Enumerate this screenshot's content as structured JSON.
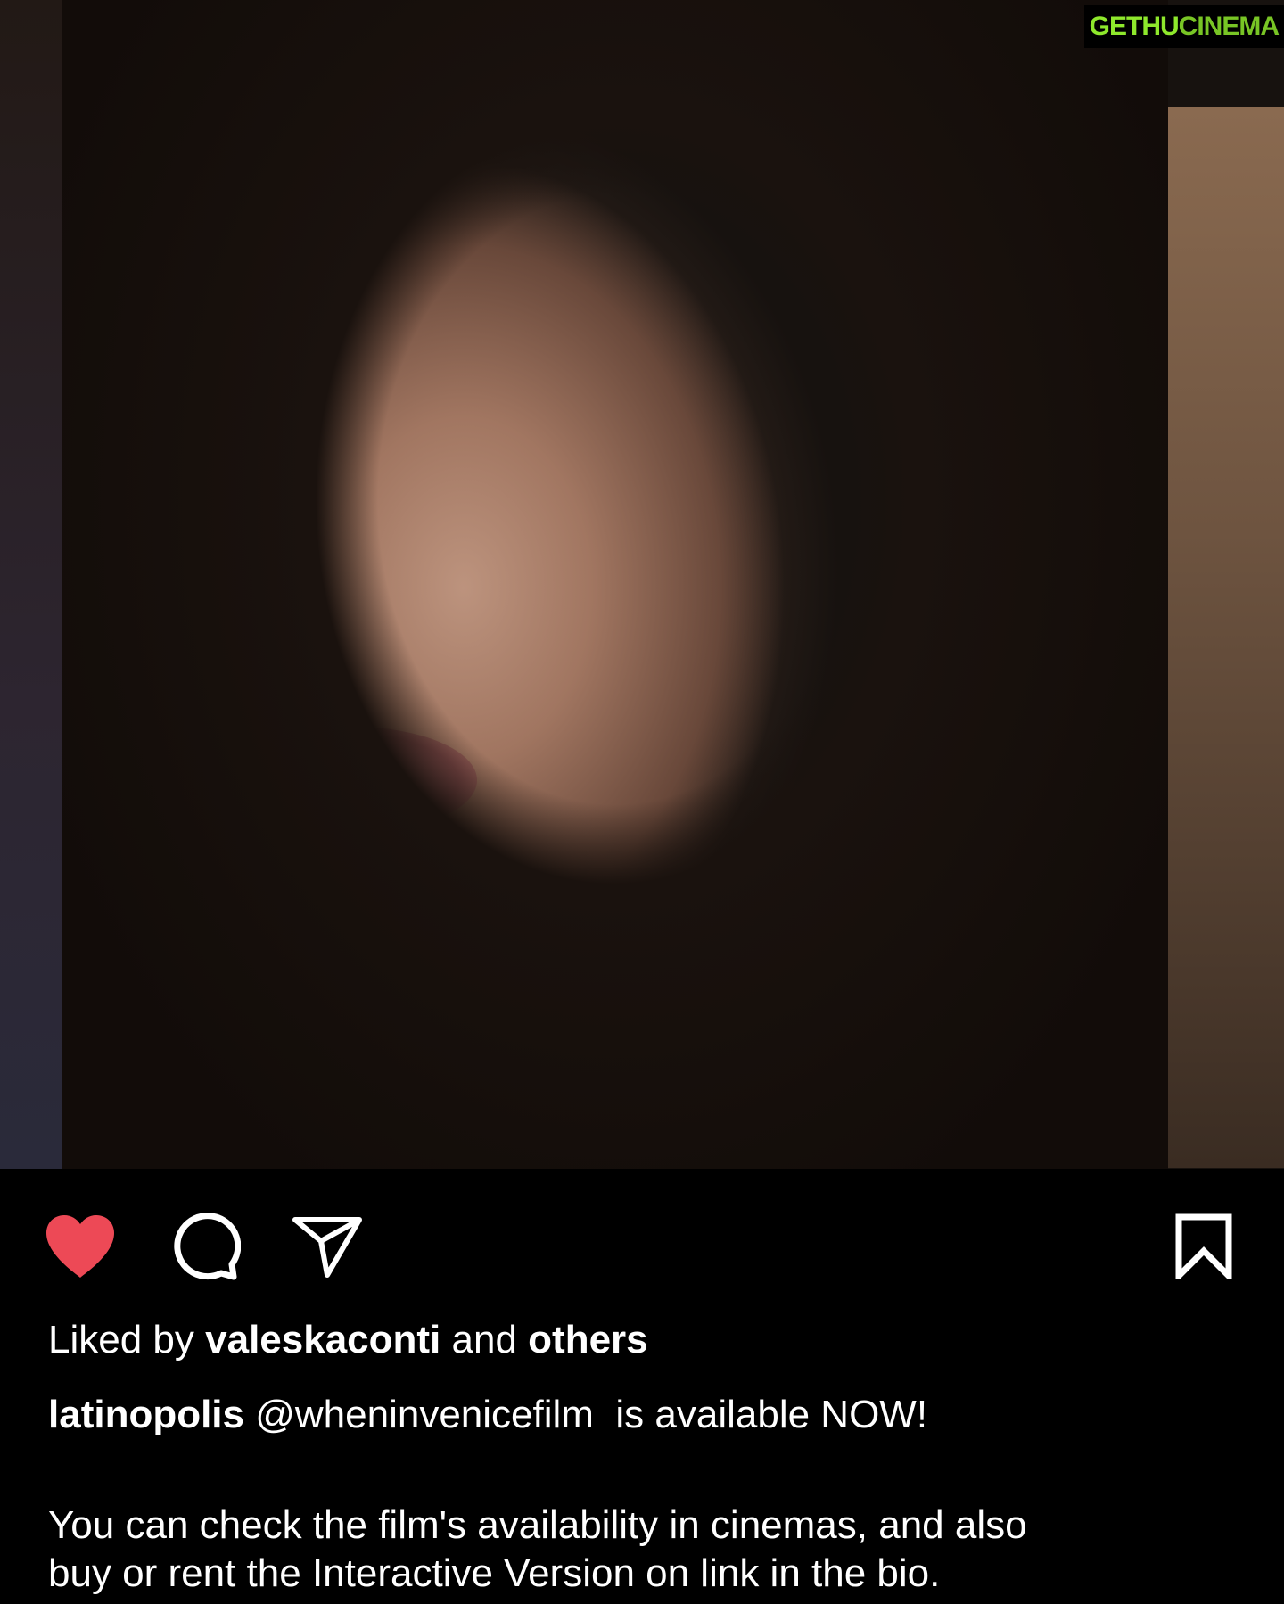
{
  "post": {
    "watermark": {
      "part1": "GETHU",
      "part2": "CINEMA"
    }
  },
  "actions": {
    "like": {
      "icon": "heart-filled-icon",
      "liked": true,
      "color": "#ed4956"
    },
    "comment": {
      "icon": "comment-icon"
    },
    "share": {
      "icon": "send-icon"
    },
    "save": {
      "icon": "bookmark-icon"
    }
  },
  "likes": {
    "prefix": "Liked by",
    "user": "valeskaconti",
    "conjunction": "and",
    "others": "others"
  },
  "caption": {
    "username": "latinopolis",
    "mention": "@wheninvenicefilm",
    "text": "is available NOW!",
    "line1": "You can check the film's availability in cinemas, and also",
    "line2": "buy or rent the Interactive Version on link in the bio."
  }
}
